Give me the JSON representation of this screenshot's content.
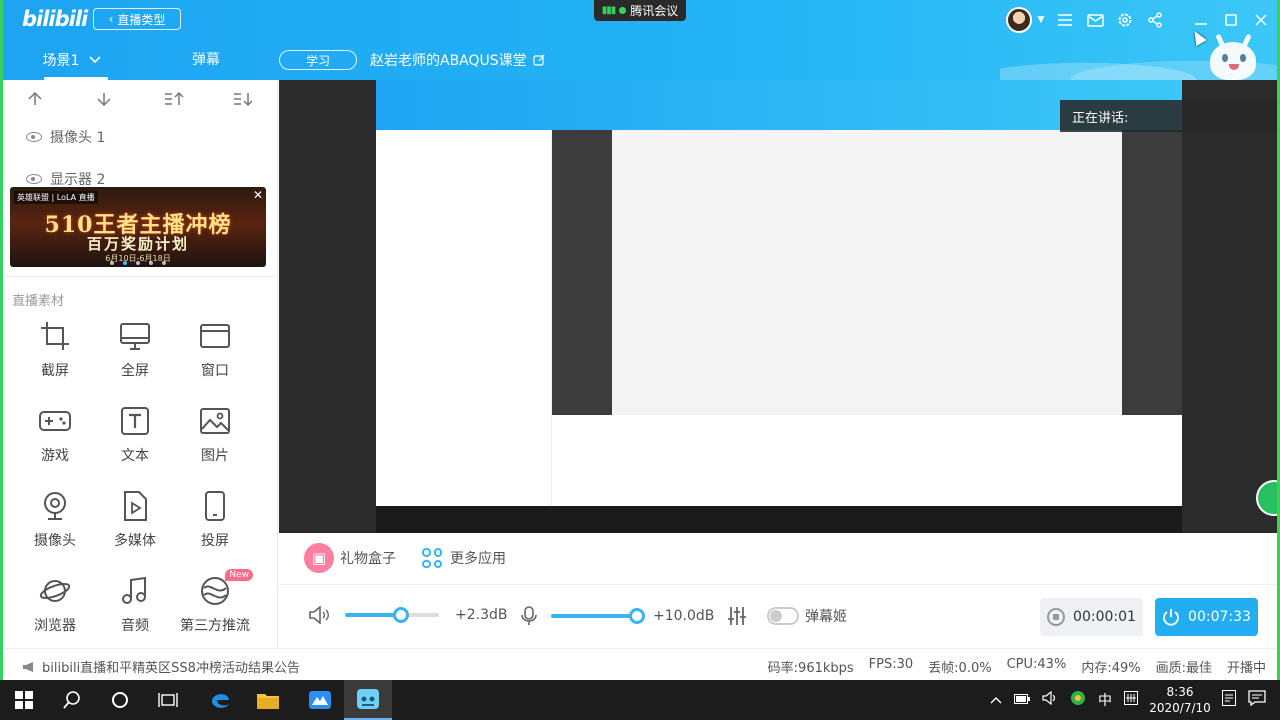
{
  "header": {
    "logo": "bilibili",
    "live_type_button": "直播类型",
    "meeting_pill": "腾讯会议",
    "scene_tab": "场景1",
    "danmu_tab": "弹幕",
    "category": "学习",
    "room_title": "赵岩老师的ABAQUS课堂"
  },
  "sidebar": {
    "sources": [
      {
        "label": "摄像头 1"
      },
      {
        "label": "显示器 2"
      }
    ],
    "banner": {
      "tag": "英雄联盟 | LoLA 直播",
      "line1": "510王者主播冲榜",
      "line2": "百万奖励计划",
      "line3": "6月10日-6月18日"
    },
    "materials_title": "直播素材",
    "tools": [
      {
        "label": "截屏",
        "icon": "crop-icon"
      },
      {
        "label": "全屏",
        "icon": "monitor-icon"
      },
      {
        "label": "窗口",
        "icon": "window-icon"
      },
      {
        "label": "游戏",
        "icon": "gamepad-icon"
      },
      {
        "label": "文本",
        "icon": "text-icon"
      },
      {
        "label": "图片",
        "icon": "image-icon"
      },
      {
        "label": "摄像头",
        "icon": "webcam-icon"
      },
      {
        "label": "多媒体",
        "icon": "media-file-icon"
      },
      {
        "label": "投屏",
        "icon": "phone-icon"
      },
      {
        "label": "浏览器",
        "icon": "planet-icon"
      },
      {
        "label": "音频",
        "icon": "music-icon"
      },
      {
        "label": "第三方推流",
        "icon": "stream-icon",
        "badge": "New"
      }
    ]
  },
  "preview": {
    "speaking_label": "正在讲话:"
  },
  "actions": {
    "gift": "礼物盒子",
    "more_apps": "更多应用"
  },
  "controls": {
    "speaker_db": "+2.3dB",
    "speaker_level": 0.6,
    "mic_db": "+10.0dB",
    "mic_level": 1.0,
    "danmu_ji": "弹幕姬",
    "record_time": "00:00:01",
    "live_time": "00:07:33"
  },
  "status": {
    "notice": "bilibili直播和平精英区SS8冲榜活动结果公告",
    "bitrate": "码率:961kbps",
    "fps": "FPS:30",
    "dropped": "丢帧:0.0%",
    "cpu": "CPU:43%",
    "mem": "内存:49%",
    "quality": "画质:最佳",
    "playing": "开播中"
  },
  "taskbar": {
    "ime": "中",
    "time": "8:36",
    "date": "2020/7/10"
  },
  "colors": {
    "brand_blue": "#23aef2",
    "accent_pink": "#ff7fa0",
    "edge_green": "#3ad05c"
  }
}
